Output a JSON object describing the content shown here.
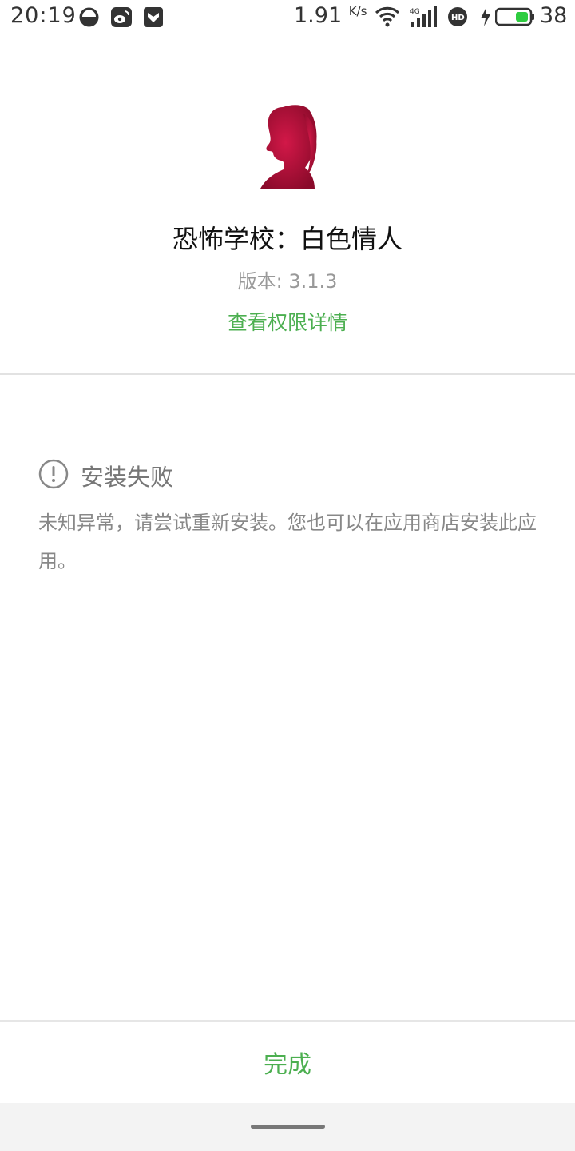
{
  "status_bar": {
    "time": "20:19",
    "net_speed": "1.91",
    "net_speed_unit": "K/s",
    "network_type": "4G",
    "battery_percent": "38",
    "icons": [
      "qq-browser-icon",
      "weibo-icon",
      "shield-app-icon",
      "wifi-icon",
      "signal-4g-icon",
      "hd-icon",
      "charging-icon",
      "battery-icon"
    ]
  },
  "app": {
    "icon": "girl-silhouette-icon",
    "name": "恐怖学校：白色情人",
    "version_label": "版本: 3.1.3",
    "permissions_link": "查看权限详情"
  },
  "result": {
    "title": "安装失败",
    "message": "未知异常，请尝试重新安装。您也可以在应用商店安装此应用。"
  },
  "footer": {
    "done_label": "完成"
  },
  "colors": {
    "accent": "#4caf50",
    "app_icon_red": "#b0103a"
  }
}
